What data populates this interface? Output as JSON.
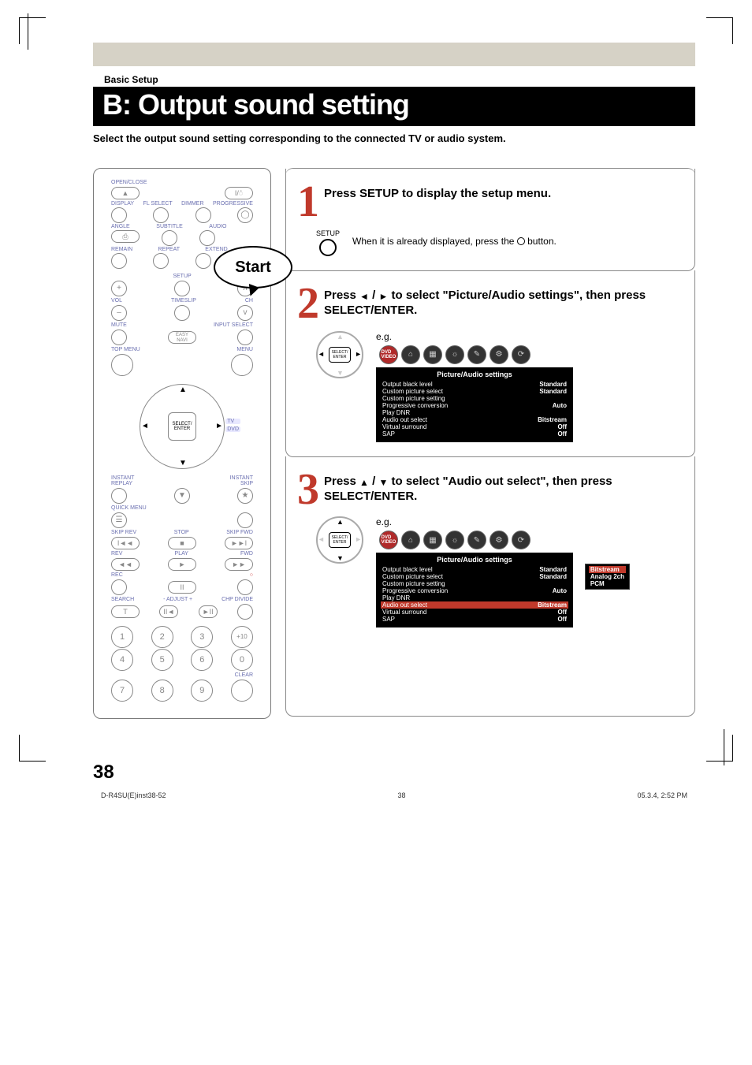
{
  "breadcrumb": "Basic Setup",
  "title": "B: Output sound setting",
  "subtitle": "Select the output sound setting corresponding to the connected TV or audio system.",
  "remote": {
    "start_label": "Start",
    "labels": {
      "open_close": "OPEN/CLOSE",
      "display": "DISPLAY",
      "fl_select": "FL SELECT",
      "dimmer": "DIMMER",
      "progressive": "PROGRESSIVE",
      "angle": "ANGLE",
      "subtitle": "SUBTITLE",
      "audio": "AUDIO",
      "remain": "REMAIN",
      "setup": "SETUP",
      "vol": "VOL",
      "timeslip": "TIMESLIP",
      "ch": "CH",
      "mute": "MUTE",
      "input_select": "INPUT SELECT",
      "top_menu": "TOP MENU",
      "easy_navi": "EASY\nNAVI",
      "menu": "MENU",
      "select_enter": "SELECT/\nENTER",
      "tv": "TV",
      "dvd": "DVD",
      "instant_replay": "INSTANT\nREPLAY",
      "instant_skip": "INSTANT\nSKIP",
      "quick_menu": "QUICK MENU",
      "skip_rev": "SKIP REV",
      "stop": "STOP",
      "skip_fwd": "SKIP FWD",
      "rev": "REV",
      "play": "PLAY",
      "fwd": "FWD",
      "rec": "REC",
      "search": "SEARCH",
      "adjust": "- ADJUST +",
      "chp_divide": "CHP DIVIDE",
      "clear": "CLEAR",
      "repeat": "REPEAT",
      "extend": "EXTEND"
    }
  },
  "steps": [
    {
      "num": "1",
      "title": "Press SETUP to display the setup menu.",
      "button_label": "SETUP",
      "hint_pre": "When it is already displayed, press the ",
      "hint_post": " button."
    },
    {
      "num": "2",
      "title_pre": "Press ",
      "title_mid": " to select \"Picture/Audio settings\", then press SELECT/ENTER.",
      "dpad_label": "SELECT/\nENTER",
      "eg": "e.g.",
      "osd_title": "Picture/Audio settings",
      "dvd_label": "DVD\nVIDEO",
      "rows": [
        {
          "k": "Output black level",
          "v": "Standard"
        },
        {
          "k": "Custom picture select",
          "v": "Standard"
        },
        {
          "k": "Custom picture setting",
          "v": ""
        },
        {
          "k": "Progressive conversion",
          "v": "Auto"
        },
        {
          "k": "Play DNR",
          "v": ""
        },
        {
          "k": "Audio out select",
          "v": "Bitstream"
        },
        {
          "k": "Virtual surround",
          "v": "Off"
        },
        {
          "k": "SAP",
          "v": "Off"
        }
      ]
    },
    {
      "num": "3",
      "title_pre": "Press ",
      "title_mid": " to select \"Audio out select\", then press SELECT/ENTER.",
      "dpad_label": "SELECT/\nENTER",
      "eg": "e.g.",
      "osd_title": "Picture/Audio settings",
      "dvd_label": "DVD\nVIDEO",
      "rows": [
        {
          "k": "Output black level",
          "v": "Standard"
        },
        {
          "k": "Custom picture select",
          "v": "Standard"
        },
        {
          "k": "Custom picture setting",
          "v": ""
        },
        {
          "k": "Progressive conversion",
          "v": "Auto"
        },
        {
          "k": "Play DNR",
          "v": ""
        },
        {
          "k": "Audio out select",
          "v": "Bitstream",
          "hl": true
        },
        {
          "k": "Virtual surround",
          "v": "Off"
        },
        {
          "k": "SAP",
          "v": "Off"
        }
      ],
      "popup": [
        "Bitstream",
        "Analog 2ch",
        "PCM"
      ]
    }
  ],
  "page_number": "38",
  "footer": {
    "file": "D-R4SU(E)inst38-52",
    "pg": "38",
    "ts": "05.3.4, 2:52 PM"
  }
}
